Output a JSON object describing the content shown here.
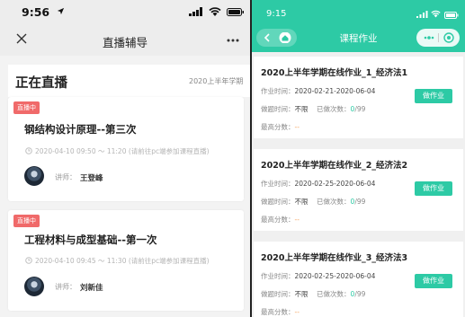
{
  "left": {
    "status_time": "9:56",
    "nav_title": "直播辅导",
    "section_title": "正在直播",
    "semester": "2020上半年学期",
    "cards": [
      {
        "badge": "直播中",
        "title": "钢结构设计原理--第三次",
        "time": "2020-04-10 09:50 ～ 11:20 (请前往pc端参加课程直播)",
        "teacher_label": "讲师：",
        "teacher_name": "王登峰"
      },
      {
        "badge": "直播中",
        "title": "工程材料与成型基础--第一次",
        "time": "2020-04-10 09:45 ～ 11:30 (请前往pc端参加课程直播)",
        "teacher_label": "讲师：",
        "teacher_name": "刘新佳"
      }
    ]
  },
  "right": {
    "status_time": "9:15",
    "nav_title": "课程作业",
    "accent_color": "#2dcaa5",
    "assignments": [
      {
        "title": "2020上半年学期在线作业_1_经济法1",
        "time_label": "作业时间：",
        "time_value": "2020-02-21-2020-06-04",
        "times_label": "做题时间：",
        "times_value": "不限",
        "done_label": "已做次数：",
        "done_count": "0",
        "done_total": "/99",
        "score_label": "最高分数：",
        "score_value": "--",
        "button": "做作业"
      },
      {
        "title": "2020上半年学期在线作业_2_经济法2",
        "time_label": "作业时间：",
        "time_value": "2020-02-25-2020-06-04",
        "times_label": "做题时间：",
        "times_value": "不限",
        "done_label": "已做次数：",
        "done_count": "0",
        "done_total": "/99",
        "score_label": "最高分数：",
        "score_value": "--",
        "button": "做作业"
      },
      {
        "title": "2020上半年学期在线作业_3_经济法3",
        "time_label": "作业时间：",
        "time_value": "2020-02-25-2020-06-04",
        "times_label": "做题时间：",
        "times_value": "不限",
        "done_label": "已做次数：",
        "done_count": "0",
        "done_total": "/99",
        "score_label": "最高分数：",
        "score_value": "--",
        "button": "做作业"
      }
    ]
  }
}
